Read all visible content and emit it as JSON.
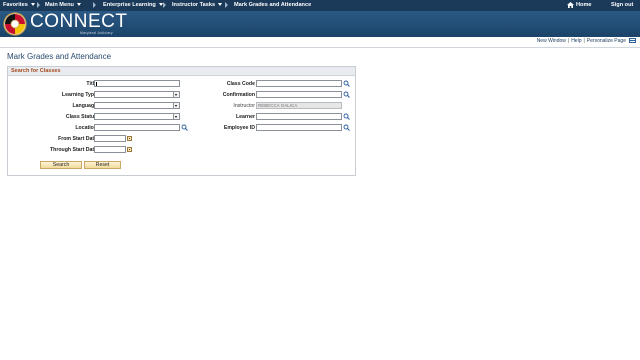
{
  "topnav": {
    "items": [
      "Favorites",
      "Main Menu",
      "Enterprise Learning",
      "Instructor Tasks",
      "Mark Grades and Attendance"
    ],
    "home": "Home",
    "signout": "Sign out"
  },
  "banner": {
    "logo": "CONNECT",
    "subtitle": "Maryland Judiciary"
  },
  "pagebar": {
    "new_window": "New Window",
    "help": "Help",
    "personalize": "Personalize Page"
  },
  "page_title": "Mark Grades and Attendance",
  "panel": {
    "header": "Search for Classes",
    "labels": {
      "title": "Title",
      "learning_type": "Learning Type",
      "language": "Language",
      "class_status": "Class Status",
      "location": "Location",
      "from_start_date": "From Start Date",
      "through_start_date": "Through Start Date",
      "class_code": "Class Code",
      "confirmation": "Confirmation",
      "instructor": "Instructor",
      "learner": "Learner",
      "employee_id": "Employee ID"
    },
    "values": {
      "instructor": "REBECCA GALICA"
    },
    "buttons": {
      "search": "Search",
      "reset": "Reset"
    }
  },
  "colors": {
    "nav_bg": "#1b3a5a",
    "banner_bg": "#2a5985",
    "header_text": "#a84a1e",
    "title": "#2a4a6f"
  }
}
